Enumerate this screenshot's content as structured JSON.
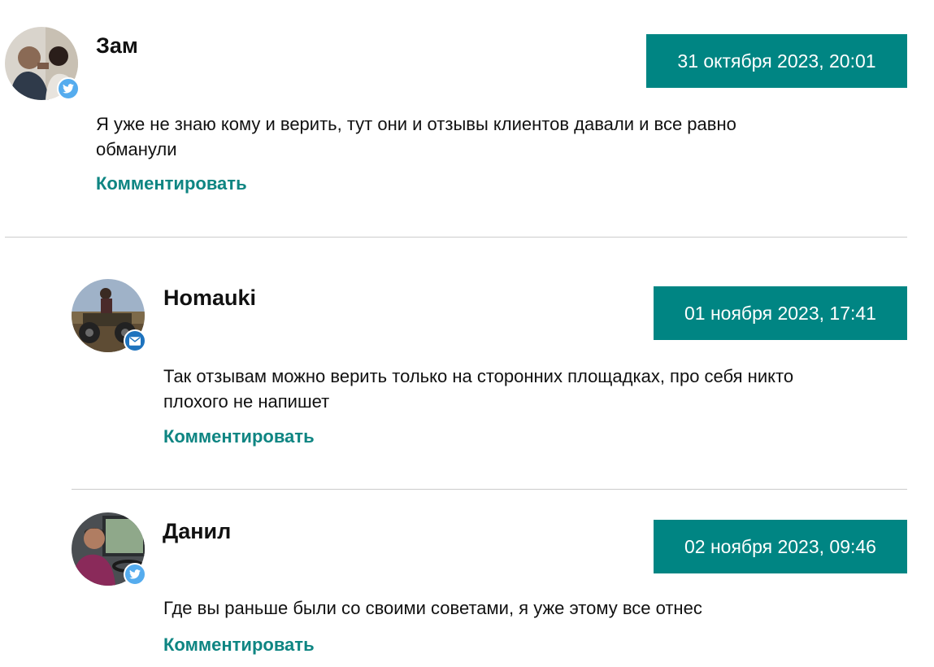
{
  "comments": [
    {
      "author": "Зам",
      "date": "31 октября 2023, 20:01",
      "text": "Я уже не знаю кому и верить, тут они и отзывы клиентов давали и все равно обманули",
      "reply_label": "Комментировать",
      "badge_icon": "twitter-icon"
    },
    {
      "author": "Homauki",
      "date": "01 ноября 2023, 17:41",
      "text": "Так отзывам можно верить только на сторонних площадках, про себя никто плохого не напишет",
      "reply_label": "Комментировать",
      "badge_icon": "mail-icon"
    },
    {
      "author": "Данил",
      "date": "02 ноября 2023, 09:46",
      "text": "Где вы раньше были со своими советами, я уже этому все отнес",
      "reply_label": "Комментировать",
      "badge_icon": "twitter-icon"
    }
  ],
  "colors": {
    "accent": "#008583",
    "link": "#0e8582",
    "twitter": "#55acee",
    "mail": "#1e73be",
    "divider": "#cccccc"
  }
}
